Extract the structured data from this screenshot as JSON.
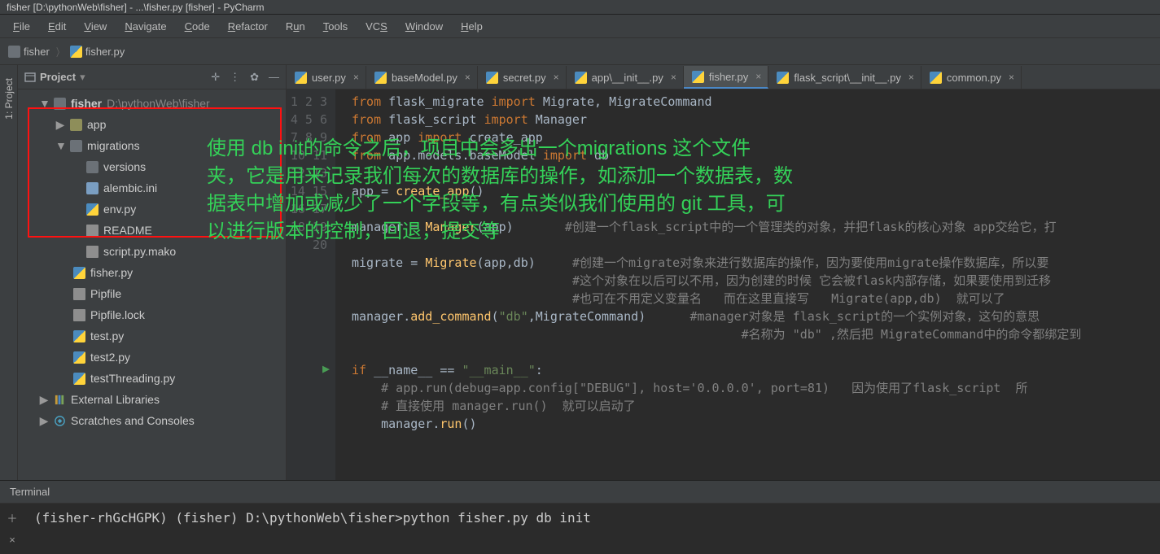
{
  "window": {
    "title": "fisher [D:\\pythonWeb\\fisher] - ...\\fisher.py [fisher] - PyCharm"
  },
  "menu": {
    "file": "File",
    "edit": "Edit",
    "view": "View",
    "navigate": "Navigate",
    "code": "Code",
    "refactor": "Refactor",
    "run": "Run",
    "tools": "Tools",
    "vcs": "VCS",
    "window": "Window",
    "help": "Help"
  },
  "breadcrumb": {
    "root": "fisher",
    "file": "fisher.py"
  },
  "side_tab": {
    "label": "1: Project"
  },
  "project_panel": {
    "title": "Project",
    "root": {
      "name": "fisher",
      "path": "D:\\pythonWeb\\fisher"
    },
    "app": "app",
    "migrations": "migrations",
    "versions": "versions",
    "alembic": "alembic.ini",
    "envpy": "env.py",
    "readme": "README",
    "scriptmako": "script.py.mako",
    "fisherpy": "fisher.py",
    "pipfile": "Pipfile",
    "pipfilelock": "Pipfile.lock",
    "testpy": "test.py",
    "test2py": "test2.py",
    "testthreading": "testThreading.py",
    "extlib": "External Libraries",
    "scratches": "Scratches and Consoles"
  },
  "tabs": [
    {
      "label": "user.py",
      "active": false
    },
    {
      "label": "baseModel.py",
      "active": false
    },
    {
      "label": "secret.py",
      "active": false
    },
    {
      "label": "app\\__init__.py",
      "active": false
    },
    {
      "label": "fisher.py",
      "active": true
    },
    {
      "label": "flask_script\\__init__.py",
      "active": false
    },
    {
      "label": "common.py",
      "active": false
    }
  ],
  "code": {
    "l1": {
      "a": "from",
      "b": "flask_migrate",
      "c": "import",
      "d": "Migrate, MigrateCommand"
    },
    "l2": {
      "a": "from",
      "b": "flask_script",
      "c": "import",
      "d": "Manager"
    },
    "l3": {
      "a": "from",
      "b": "app",
      "c": "import",
      "d": "create_app"
    },
    "l4": {
      "a": "from",
      "b": "app.models.baseModel",
      "c": "import",
      "d": "db"
    },
    "l6": {
      "a": "app =",
      "b": "create_app",
      "c": "()"
    },
    "l8": {
      "a": "manager =",
      "b": "Manager",
      "c": "(app)",
      "cmt": "#创建一个flask_script中的一个管理类的对象，并把flask的核心对象 app交给它，打"
    },
    "l10": {
      "a": "migrate =",
      "b": "Migrate",
      "c": "(app,db)",
      "cmt": "#创建一个migrate对象来进行数据库的操作，因为要使用migrate操作数据库，所以要"
    },
    "l11": {
      "cmt": "#这个对象在以后可以不用，因为创建的时候 它会被flask内部存储，如果要使用到迁移"
    },
    "l12": {
      "cmt": "#也可在不用定义变量名   而在这里直接写   Migrate(app,db)  就可以了"
    },
    "l13": {
      "a": "manager.",
      "b": "add_command",
      "c": "(",
      "s": "\"db\"",
      "d": ",MigrateCommand)",
      "cmt": "#manager对象是 flask_script的一个实例对象，这句的意思"
    },
    "l13b": {
      "cmt": "#名称为 \"db\" ,然后把 MigrateCommand中的命令都绑定到"
    },
    "l16": {
      "a": "if",
      "b": "__name__",
      "c": "==",
      "s": "\"__main__\"",
      "d": ":"
    },
    "l17": {
      "cmt": "# app.run(debug=app.config[\"DEBUG\"], host='0.0.0.0', port=81)   因为使用了flask_script  所"
    },
    "l18": {
      "cmt": "# 直接使用 manager.run()  就可以启动了"
    },
    "l19": {
      "a": "manager.",
      "b": "run",
      "c": "()"
    }
  },
  "overlay": {
    "line1": "使用 db init的命令之后，项目中会多出一个migrations 这个文件",
    "line2": "夹，它是用来记录我们每次的数据库的操作，如添加一个数据表，数",
    "line3": "据表中增加或减少了一个字段等，有点类似我们使用的 git 工具，可",
    "line4": "以进行版本的控制，回退，提交等"
  },
  "terminal": {
    "title": "Terminal",
    "line": "(fisher-rhGcHGPK) (fisher) D:\\pythonWeb\\fisher>python fisher.py db init"
  }
}
